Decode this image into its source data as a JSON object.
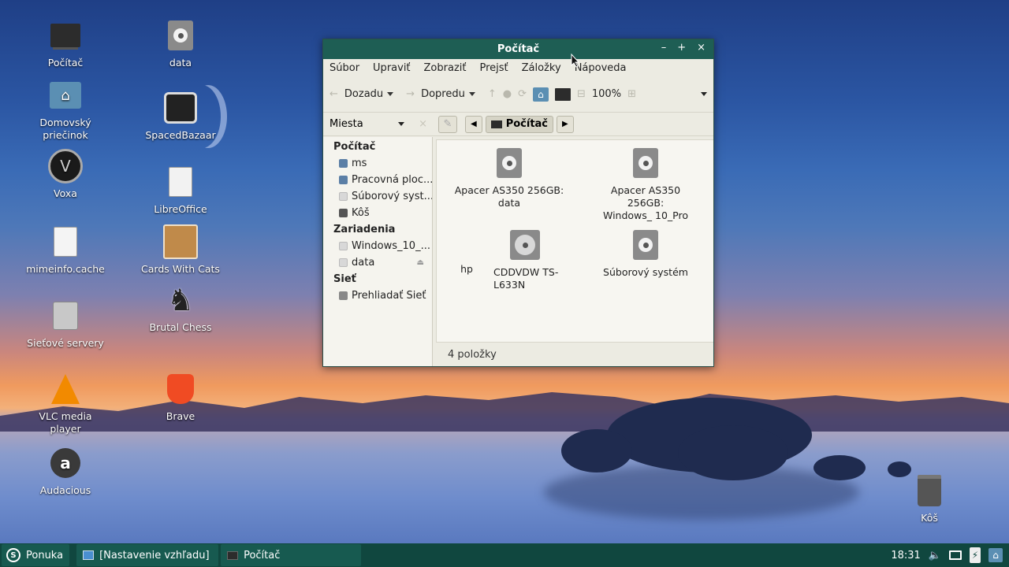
{
  "desktop": {
    "icons": [
      {
        "label": "Počítač",
        "icon": "computer-icon"
      },
      {
        "label": "data",
        "icon": "drive-icon"
      },
      {
        "label": "Domovský priečinok",
        "icon": "home-folder-icon"
      },
      {
        "label": "SpacedBazaar",
        "icon": "spacedbazaar-icon"
      },
      {
        "label": "Voxa",
        "icon": "voxa-icon"
      },
      {
        "label": "LibreOffice",
        "icon": "document-icon"
      },
      {
        "label": "mimeinfo.cache",
        "icon": "text-file-icon"
      },
      {
        "label": "Cards With Cats",
        "icon": "cards-with-cats-icon"
      },
      {
        "label": "Brutal Chess",
        "icon": "chess-knight-icon"
      },
      {
        "label": "Sieťové servery",
        "icon": "network-servers-icon"
      },
      {
        "label": "VLC media player",
        "icon": "vlc-cone-icon"
      },
      {
        "label": "Brave",
        "icon": "brave-lion-icon"
      },
      {
        "label": "Audacious",
        "icon": "audacious-icon"
      },
      {
        "label": "Kôš",
        "icon": "trash-icon"
      }
    ]
  },
  "window": {
    "title": "Počítač",
    "controls": {
      "minimize": "–",
      "maximize": "+",
      "close": "×"
    },
    "menu": [
      "Súbor",
      "Upraviť",
      "Zobraziť",
      "Prejsť",
      "Záložky",
      "Nápoveda"
    ],
    "toolbar": {
      "back_label": "Dozadu",
      "forward_label": "Dopredu",
      "zoom": "100%"
    },
    "places_label": "Miesta",
    "path_current": "Počítač",
    "sidebar": [
      {
        "type": "section",
        "label": "Počítač"
      },
      {
        "type": "item",
        "label": "ms",
        "icon": "home-icon",
        "color": "#5b7fa6"
      },
      {
        "type": "item",
        "label": "Pracovná ploc...",
        "icon": "desktop-icon",
        "color": "#5b7fa6"
      },
      {
        "type": "item",
        "label": "Súborový syst...",
        "icon": "drive-icon",
        "color": "#d8d8d8"
      },
      {
        "type": "item",
        "label": "Kôš",
        "icon": "trash-icon",
        "color": "#555555"
      },
      {
        "type": "section",
        "label": "Zariadenia"
      },
      {
        "type": "item",
        "label": "Windows_10_...",
        "icon": "drive-icon",
        "color": "#d8d8d8"
      },
      {
        "type": "item",
        "label": "data",
        "icon": "drive-icon",
        "color": "#d8d8d8",
        "eject": true
      },
      {
        "type": "section",
        "label": "Sieť"
      },
      {
        "type": "item",
        "label": "Prehliadať Sieť",
        "icon": "network-icon",
        "color": "#888888"
      }
    ],
    "files": [
      {
        "label": "Apacer AS350 256GB: data",
        "icon": "drive-icon"
      },
      {
        "label": "Apacer AS350 256GB: Windows_ 10_Pro",
        "icon": "drive-icon"
      },
      {
        "label": "hp",
        "icon": "none"
      },
      {
        "label": "CDDVDW TS-L633N",
        "icon": "optical-drive-icon"
      },
      {
        "label": "Súborový systém",
        "icon": "drive-icon"
      }
    ],
    "status": "4 položky"
  },
  "taskbar": {
    "menu_label": "Ponuka",
    "tasks": [
      {
        "label": "[Nastavenie vzhľadu]",
        "icon": "settings-window-icon"
      },
      {
        "label": "Počítač",
        "icon": "computer-icon"
      }
    ],
    "clock": "18:31"
  },
  "colors": {
    "titlebar": "#1e5e54",
    "taskbar": "#10473f",
    "window_bg": "#ecebe2"
  }
}
